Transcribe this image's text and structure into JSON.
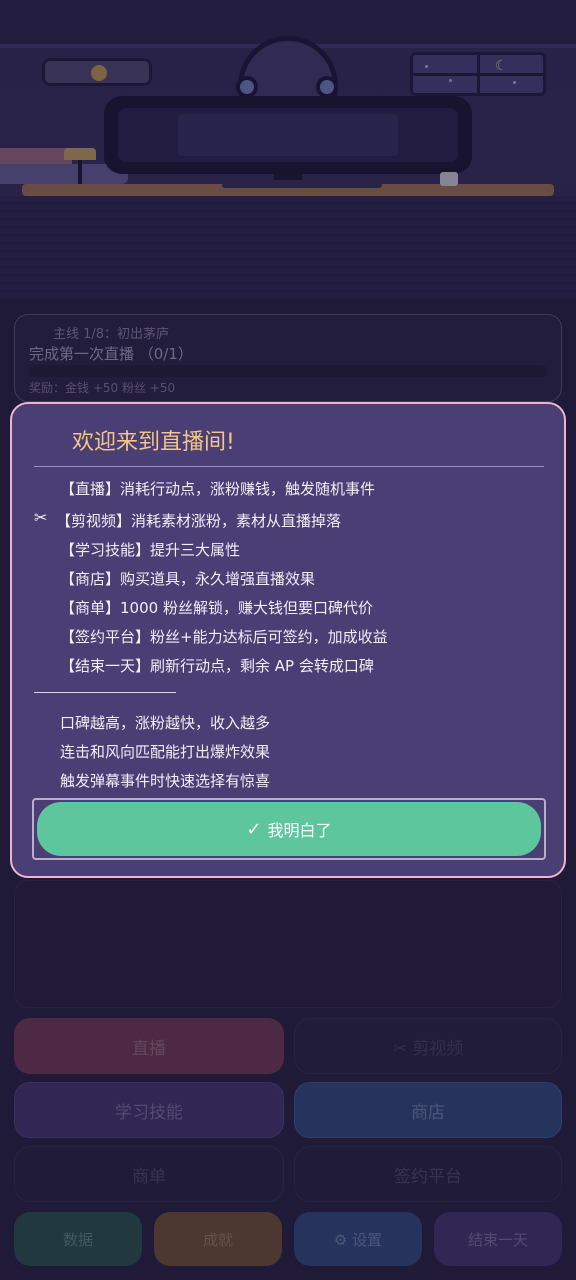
{
  "quest": {
    "title": "主线 1/8：初出茅庐",
    "description": "完成第一次直播 （0/1）",
    "reward": "奖励：金钱 +50  粉丝 +50"
  },
  "actions": {
    "live": "直播",
    "clip": "✂ 剪视频",
    "learn": "学习技能",
    "shop": "商店",
    "orders": "商单",
    "sign": "签约平台",
    "data": "数据",
    "achievements": "成就",
    "settings": "⚙ 设置",
    "end_day": "结束一天"
  },
  "modal": {
    "title": "欢迎来到直播间!",
    "items": [
      "【直播】消耗行动点，涨粉赚钱，触发随机事件",
      "【剪视频】消耗素材涨粉，素材从直播掉落",
      "【学习技能】提升三大属性",
      "【商店】购买道具，永久增强直播效果",
      "【商单】1000 粉丝解锁，赚大钱但要口碑代价",
      "【签约平台】粉丝+能力达标后可签约，加成收益",
      "【结束一天】刷新行动点，剩余 AP 会转成口碑"
    ],
    "tips": [
      "口碑越高，涨粉越快，收入越多",
      "连击和风向匹配能打出爆炸效果",
      "触发弹幕事件时快速选择有惊喜"
    ],
    "confirm_label": "我明白了",
    "scissor_glyph": "✂",
    "check_glyph": "✓"
  },
  "colors": {
    "background": "#2b2449",
    "modal_bg": "#4a3f74",
    "modal_border": "#f2b4cc",
    "title": "#f4c48a",
    "confirm": "#5ec69c"
  }
}
